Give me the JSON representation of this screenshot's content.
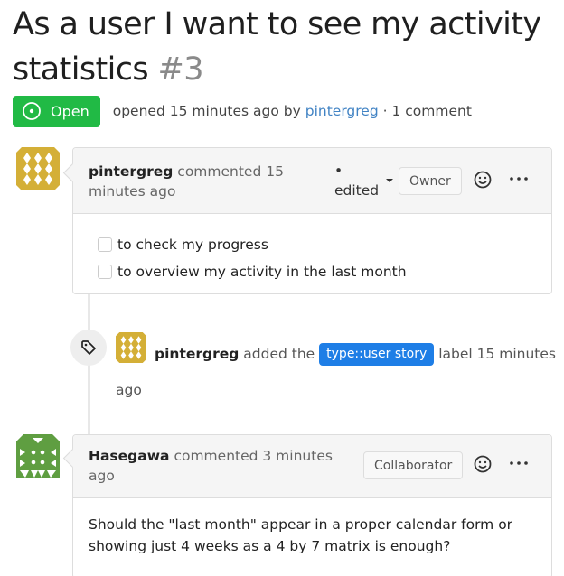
{
  "issue": {
    "title": "As a user I want to see my activity statistics",
    "number": "#3",
    "state": "Open",
    "state_color": "#21ba45",
    "meta": {
      "opened_text": "opened 15 minutes ago by",
      "author": "pintergreg",
      "separator": "·",
      "comment_count": "1 comment"
    }
  },
  "timeline": {
    "first_comment": {
      "author": "pintergreg",
      "action": "commented 15 minutes ago",
      "edited_bullet": "•",
      "edited": "edited",
      "role": "Owner",
      "avatar_color": "#d4af37",
      "tasks": [
        {
          "label": "to check my progress",
          "checked": false
        },
        {
          "label": "to overview my activity in the last month",
          "checked": false
        }
      ],
      "icons": {
        "reaction": "smiley-icon",
        "more": "ellipsis-icon",
        "edited": "caret-down-icon"
      }
    },
    "label_event": {
      "icon": "tag-icon",
      "actor": "pintergreg",
      "action_before": "added the",
      "label": "type::user story",
      "label_color": "#1e7ee6",
      "action_after": "label 15 minutes ago"
    },
    "second_comment": {
      "author": "Hasegawa",
      "action": "commented 3 minutes ago",
      "role": "Collaborator",
      "avatar_color": "#5f9e41",
      "body": "Should the \"last month\" appear in a proper calendar form or showing just 4 weeks as a 4 by 7 matrix is enough?",
      "icons": {
        "reaction": "smiley-icon",
        "more": "ellipsis-icon"
      }
    }
  }
}
